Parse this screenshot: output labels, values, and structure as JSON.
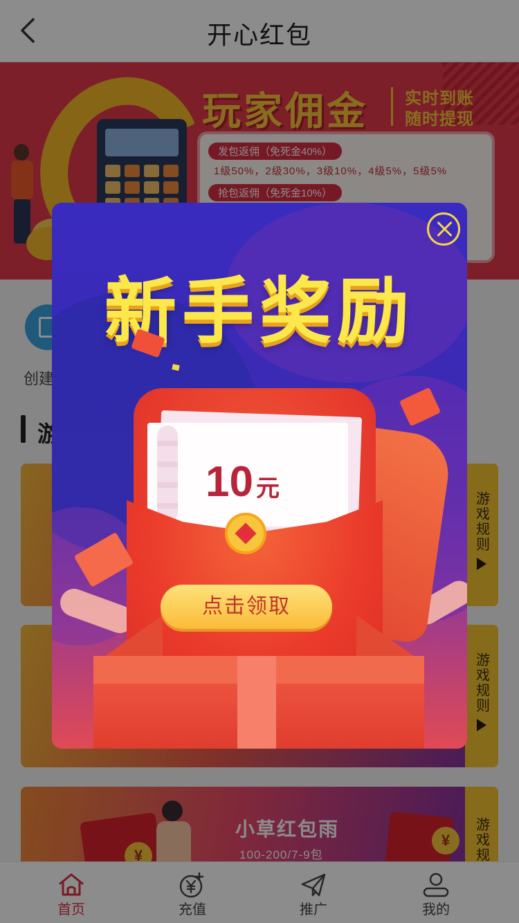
{
  "header": {
    "title": "开心红包"
  },
  "banner": {
    "title": "玩家佣金",
    "tag_line1": "实时到账",
    "tag_line2": "随时提现",
    "pill1": "发包返佣（免死金40%）",
    "rates": "1级50%，2级30%，3级10%，4级5%，5级5%",
    "pill2": "抢包返佣（免死金10%）"
  },
  "content": {
    "create_label": "创建",
    "section_title": "游",
    "rule_label": "游戏规则",
    "rule_label_partial": "游戏规",
    "game3": {
      "title": "小草红包雨",
      "subtitle": "100-200/7-9包",
      "coin_symbol": "¥"
    }
  },
  "modal": {
    "title": "新手奖励",
    "amount": "10",
    "unit": "元",
    "claim_label": "点击领取"
  },
  "tabbar": {
    "items": [
      {
        "label": "首页",
        "icon": "home-icon",
        "active": true
      },
      {
        "label": "充值",
        "icon": "recharge-icon",
        "active": false
      },
      {
        "label": "推广",
        "icon": "send-icon",
        "active": false
      },
      {
        "label": "我的",
        "icon": "profile-icon",
        "active": false
      }
    ]
  },
  "colors": {
    "accent": "#d92e44",
    "banner_bg": "#e23a4a",
    "gold": "#f7c63d",
    "modal_bg": "#3a2bc0",
    "title_yellow": "#fce84a"
  }
}
